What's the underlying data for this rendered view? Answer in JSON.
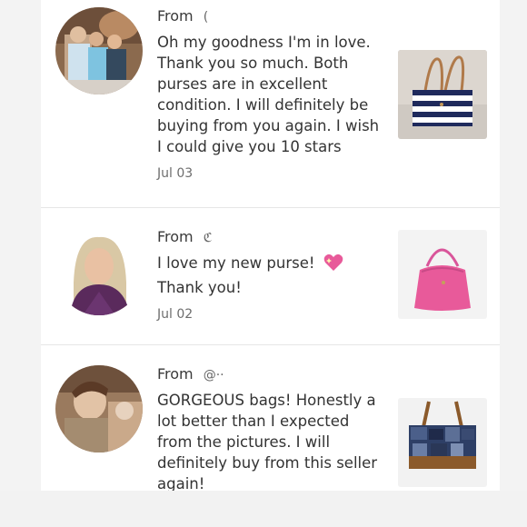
{
  "reviews": [
    {
      "from_label": "From",
      "from_user": "(",
      "message": "Oh my goodness I'm in love. Thank you so much. Both purses are in excellent condition. I will definitely be buying from you again. I wish I could give you 10 stars",
      "date": "Jul 03",
      "avatar_icon": "family-photo-avatar",
      "thumb_icon": "striped-tote-bag"
    },
    {
      "from_label": "From",
      "from_user": "ℭ",
      "message": "I love my new purse!",
      "message_line2": "Thank you!",
      "emoji": "sparkling-heart-icon",
      "date": "Jul 02",
      "avatar_icon": "woman-portrait-avatar",
      "thumb_icon": "pink-hobo-bag"
    },
    {
      "from_label": "From",
      "from_user": "@··",
      "message": "GORGEOUS bags! Honestly a lot better than I expected from the pictures. I will definitely buy from this seller again!",
      "avatar_icon": "child-photo-avatar",
      "thumb_icon": "patchwork-denim-bag"
    }
  ],
  "colors": {
    "page_bg": "#f3f3f3",
    "card_bg": "#ffffff",
    "text": "#333333",
    "muted": "#6d6d6d",
    "pink": "#e85a9a",
    "navy": "#1f2a5c"
  }
}
